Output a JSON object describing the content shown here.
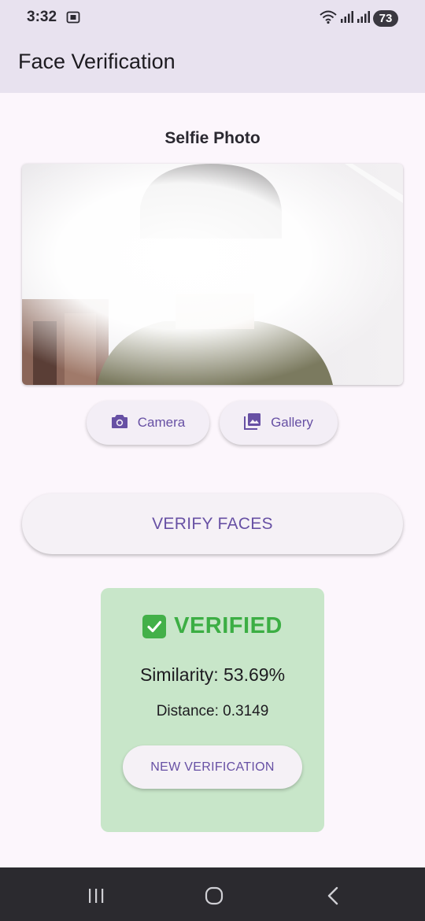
{
  "status_bar": {
    "time": "3:32",
    "battery": "73",
    "icons": [
      "screenshot-notification-icon",
      "wifi-icon",
      "signal-icon",
      "signal-icon"
    ]
  },
  "app_bar": {
    "title": "Face Verification"
  },
  "selfie": {
    "title": "Selfie Photo",
    "camera_label": "Camera",
    "gallery_label": "Gallery"
  },
  "actions": {
    "verify_label": "VERIFY FACES"
  },
  "result": {
    "status_label": "VERIFIED",
    "similarity_text": "Similarity: 53.69%",
    "distance_text": "Distance: 0.3149",
    "new_label": "NEW VERIFICATION"
  },
  "colors": {
    "accent": "#6750a4",
    "result_background": "#c8e6c9",
    "verified_green": "#3cae44",
    "app_bar_background": "#e8e2ef"
  },
  "nav_bar": {
    "icons": [
      "recent-apps-icon",
      "home-icon",
      "back-icon"
    ]
  }
}
